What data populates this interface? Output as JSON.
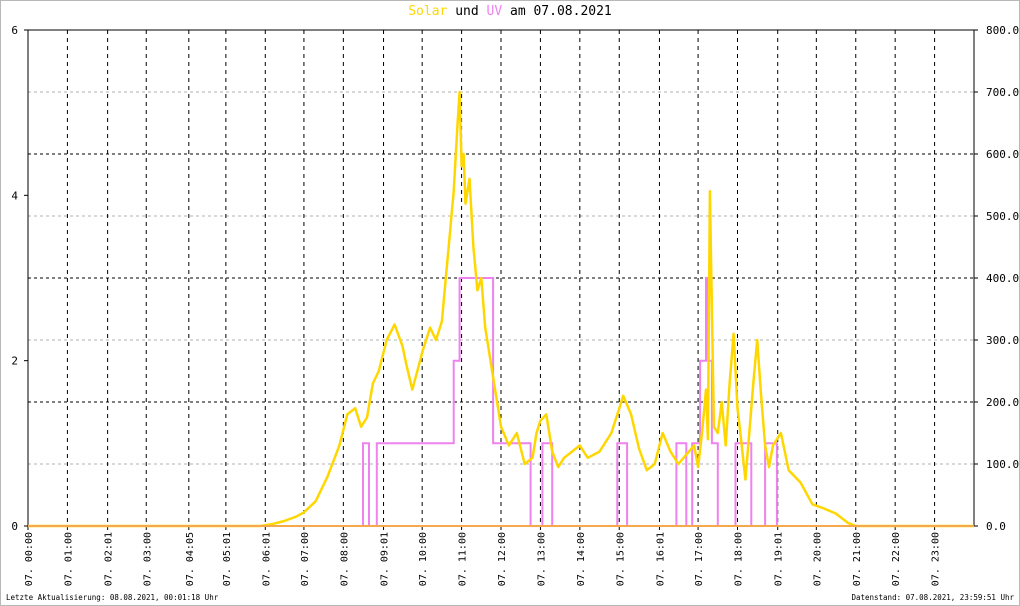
{
  "title": {
    "part_solar": "Solar",
    "part_und": " und ",
    "part_uv": "UV",
    "part_rest": " am 07.08.2021"
  },
  "colors": {
    "solar": "#ffd700",
    "uv": "#ee82ee",
    "overlap": "#f5a94c",
    "zero_line": "#f5a94c",
    "grid_major": "#000000",
    "grid_minor": "#b0b0b0"
  },
  "footer": {
    "left": "Letzte Aktualisierung: 08.08.2021, 00:01:18 Uhr",
    "right": "Datenstand: 07.08.2021, 23:59:51 Uhr"
  },
  "chart_data": {
    "type": "line",
    "title": "Solar und UV am 07.08.2021",
    "xlabel": "",
    "x_unit": "hours",
    "xlim": [
      0,
      24
    ],
    "grid": true,
    "legend": "none",
    "x_tick_labels": [
      "07. 00:00",
      "07. 01:00",
      "07. 02:01",
      "07. 03:00",
      "07. 04:05",
      "07. 05:01",
      "07. 06:01",
      "07. 07:00",
      "07. 08:00",
      "07. 09:01",
      "07. 10:00",
      "07. 11:00",
      "07. 12:00",
      "07. 13:00",
      "07. 14:00",
      "07. 15:00",
      "07. 16:01",
      "07. 17:00",
      "07. 18:00",
      "07. 19:01",
      "07. 20:00",
      "07. 21:00",
      "07. 22:00",
      "07. 23:00"
    ],
    "x_tick_hours": [
      0,
      1,
      2.02,
      3,
      4.08,
      5.02,
      6.02,
      7,
      8,
      9.02,
      10,
      11,
      12,
      13,
      14,
      15,
      16.02,
      17,
      18,
      19.02,
      20,
      21,
      22,
      23
    ],
    "y_left": {
      "label": "",
      "ylim": [
        0,
        6
      ],
      "ticks": [
        "0",
        "2",
        "4",
        "6"
      ]
    },
    "y_right": {
      "label": "",
      "ylim": [
        0,
        800
      ],
      "ticks": [
        "0.0",
        "100.0",
        "200.0",
        "300.0",
        "400.0",
        "500.0",
        "600.0",
        "700.0",
        "800.0"
      ]
    },
    "series": [
      {
        "name": "Solar",
        "axis": "right",
        "x": [
          0,
          5.9,
          6.2,
          6.5,
          6.8,
          7.0,
          7.3,
          7.6,
          7.9,
          8.1,
          8.3,
          8.45,
          8.6,
          8.75,
          8.9,
          9.1,
          9.3,
          9.5,
          9.6,
          9.75,
          9.9,
          10.0,
          10.2,
          10.35,
          10.5,
          10.6,
          10.7,
          10.8,
          10.9,
          10.95,
          11.0,
          11.05,
          11.1,
          11.2,
          11.3,
          11.4,
          11.5,
          11.6,
          11.7,
          11.8,
          11.9,
          12.0,
          12.2,
          12.4,
          12.6,
          12.8,
          12.9,
          13.0,
          13.15,
          13.3,
          13.45,
          13.6,
          13.8,
          14.0,
          14.2,
          14.5,
          14.8,
          15.0,
          15.1,
          15.3,
          15.5,
          15.7,
          15.9,
          16.1,
          16.3,
          16.5,
          16.7,
          16.9,
          17.0,
          17.1,
          17.2,
          17.25,
          17.3,
          17.4,
          17.5,
          17.6,
          17.7,
          17.8,
          17.9,
          18.0,
          18.1,
          18.2,
          18.3,
          18.4,
          18.5,
          18.6,
          18.7,
          18.8,
          18.9,
          19.1,
          19.3,
          19.6,
          19.9,
          20.2,
          20.5,
          20.8,
          21.0,
          24
        ],
        "values": [
          0,
          0,
          3,
          8,
          15,
          22,
          40,
          80,
          130,
          180,
          190,
          160,
          175,
          230,
          250,
          300,
          325,
          290,
          260,
          220,
          255,
          280,
          320,
          300,
          330,
          400,
          470,
          540,
          650,
          700,
          580,
          600,
          520,
          560,
          450,
          380,
          400,
          320,
          280,
          240,
          200,
          160,
          130,
          150,
          100,
          110,
          150,
          170,
          180,
          120,
          95,
          110,
          120,
          130,
          110,
          120,
          150,
          190,
          210,
          180,
          125,
          90,
          100,
          150,
          120,
          100,
          115,
          130,
          95,
          150,
          220,
          140,
          540,
          160,
          150,
          200,
          130,
          230,
          310,
          190,
          135,
          75,
          150,
          230,
          300,
          210,
          130,
          95,
          130,
          150,
          90,
          70,
          35,
          28,
          20,
          5,
          0,
          0
        ]
      },
      {
        "name": "UV",
        "axis": "left",
        "x": [
          0,
          8.5,
          8.5,
          8.65,
          8.65,
          8.85,
          8.85,
          9.05,
          9.05,
          10.8,
          10.8,
          10.95,
          10.95,
          11.8,
          11.8,
          12.75,
          12.75,
          13.05,
          13.05,
          13.3,
          13.3,
          14.95,
          14.95,
          15.2,
          15.2,
          16.45,
          16.45,
          16.7,
          16.7,
          16.85,
          16.85,
          17.05,
          17.05,
          17.2,
          17.2,
          17.25,
          17.25,
          17.35,
          17.35,
          17.5,
          17.5,
          17.95,
          17.95,
          18.35,
          18.35,
          18.7,
          18.7,
          18.8,
          18.8,
          19.0,
          19.0,
          24
        ],
        "values": [
          0,
          0,
          1,
          1,
          0,
          0,
          1,
          1,
          1,
          1,
          2,
          2,
          3,
          3,
          1,
          1,
          0,
          0,
          1,
          1,
          0,
          0,
          1,
          1,
          0,
          0,
          1,
          1,
          0,
          0,
          1,
          1,
          2,
          2,
          3,
          3,
          2,
          2,
          1,
          1,
          0,
          0,
          1,
          1,
          0,
          0,
          1,
          1,
          1,
          1,
          0,
          0
        ]
      }
    ]
  }
}
